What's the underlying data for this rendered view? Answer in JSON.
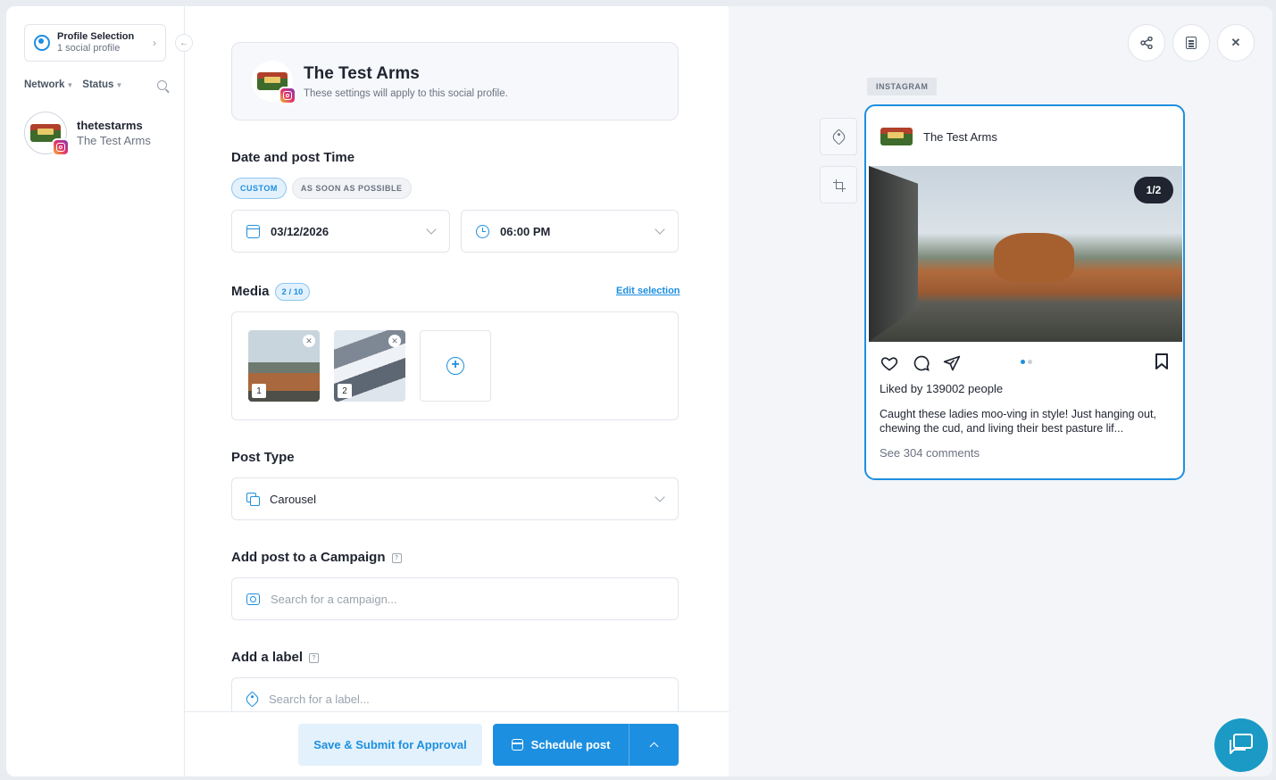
{
  "sidebar": {
    "profile_selection": {
      "title": "Profile Selection",
      "subtitle": "1 social profile"
    },
    "filters": {
      "network": "Network",
      "status": "Status"
    },
    "account": {
      "handle": "thetestarms",
      "name": "The Test Arms"
    }
  },
  "form": {
    "profile": {
      "name": "The Test Arms",
      "subtitle": "These settings will apply to this social profile."
    },
    "date_time": {
      "title": "Date and post Time",
      "chips": [
        "CUSTOM",
        "AS SOON AS POSSIBLE"
      ],
      "date": "03/12/2026",
      "time": "06:00 PM"
    },
    "media": {
      "title": "Media",
      "count": "2 / 10",
      "edit_label": "Edit selection",
      "items": [
        "1",
        "2"
      ]
    },
    "post_type": {
      "title": "Post Type",
      "value": "Carousel"
    },
    "campaign": {
      "title": "Add post to a Campaign",
      "placeholder": "Search for a campaign..."
    },
    "label": {
      "title": "Add a label",
      "placeholder": "Search for a label..."
    },
    "buttons": {
      "approve": "Save & Submit for Approval",
      "schedule": "Schedule post"
    }
  },
  "preview": {
    "network": "INSTAGRAM",
    "account_name": "The Test Arms",
    "slide_counter": "1/2",
    "likes": "Liked by 139002 people",
    "caption": "Caught these ladies moo-ving in style! Just hanging out, chewing the cud, and living their best pasture lif...",
    "comments": "See 304 comments"
  },
  "colors": {
    "accent": "#1d8fe0",
    "chat": "#1a9ac4"
  }
}
